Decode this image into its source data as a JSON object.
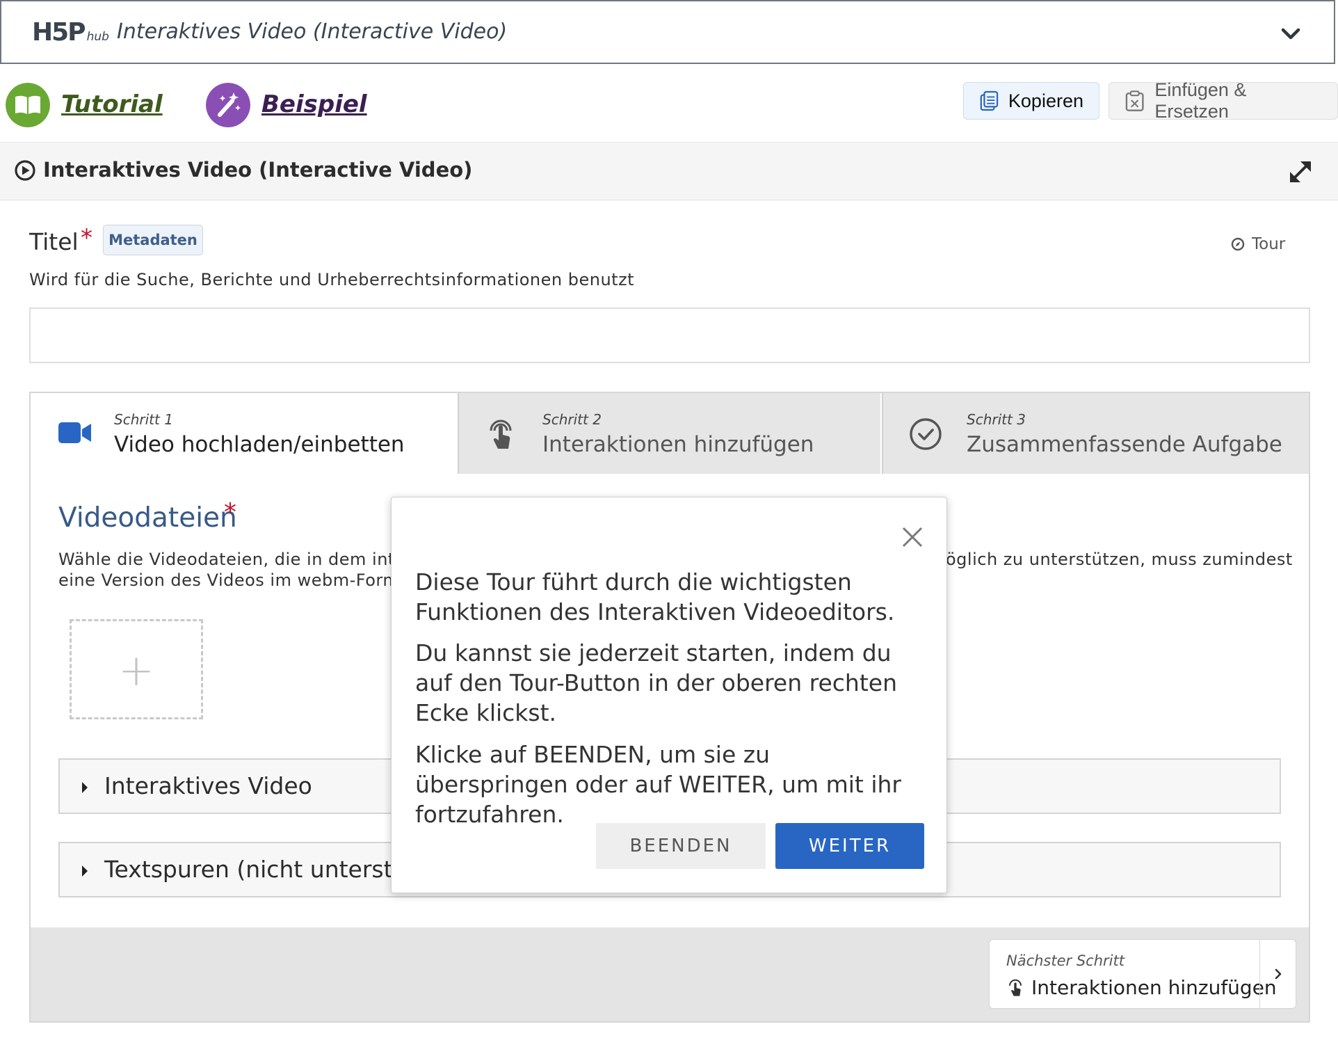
{
  "hub": {
    "logo_text": "H5P",
    "logo_suffix": "hub",
    "title": "Interaktives Video (Interactive Video)"
  },
  "links": {
    "tutorial": "Tutorial",
    "example": "Beispiel"
  },
  "toolbar": {
    "copy_label": "Kopieren",
    "paste_label": "Einfügen & Ersetzen"
  },
  "section": {
    "title": "Interaktives Video (Interactive Video)"
  },
  "title_field": {
    "label": "Titel",
    "required_mark": "*",
    "metadata_label": "Metadaten",
    "description": "Wird für die Suche, Berichte und Urheberrechtsinformationen benutzt",
    "value": ""
  },
  "tour_link": "Tour",
  "steps": [
    {
      "number": "Schritt 1",
      "label": "Video hochladen/einbetten",
      "active": true
    },
    {
      "number": "Schritt 2",
      "label": "Interaktionen hinzufügen",
      "active": false
    },
    {
      "number": "Schritt 3",
      "label": "Zusammenfassende Aufgabe",
      "active": false
    }
  ],
  "video_files": {
    "heading": "Videodateien",
    "required_mark": "*",
    "desc_line1_visible": "Wähle die Videodateien, die in dem inte",
    "desc_line2_visible": "eine Version des Videos im webm-Form",
    "desc_line1_right_visible": "öglich zu unterstützen, muss zumindest",
    "add_symbol": "+"
  },
  "groups": [
    {
      "label": "Interaktives Video"
    },
    {
      "label": "Textspuren (nicht unterstüt"
    }
  ],
  "next_step": {
    "caption": "Nächster Schritt",
    "label": "Interaktionen hinzufügen"
  },
  "tour_dialog": {
    "paragraph1": "Diese Tour führt durch die wichtigsten Funktionen des Interaktiven Videoeditors.",
    "paragraph2": "Du kannst sie jederzeit starten, indem du auf den Tour-Button in der oberen rechten Ecke klickst.",
    "paragraph3": "Klicke auf BEENDEN, um sie zu überspringen oder auf WEITER, um mit ihr fortzufahren.",
    "end_label": "BEENDEN",
    "next_label": "WEITER"
  },
  "colors": {
    "accent_blue": "#2966c4",
    "heading_blue": "#365a88",
    "required_red": "#c8102e",
    "tutorial_green": "#6aa834",
    "example_purple": "#8a4fb4"
  }
}
